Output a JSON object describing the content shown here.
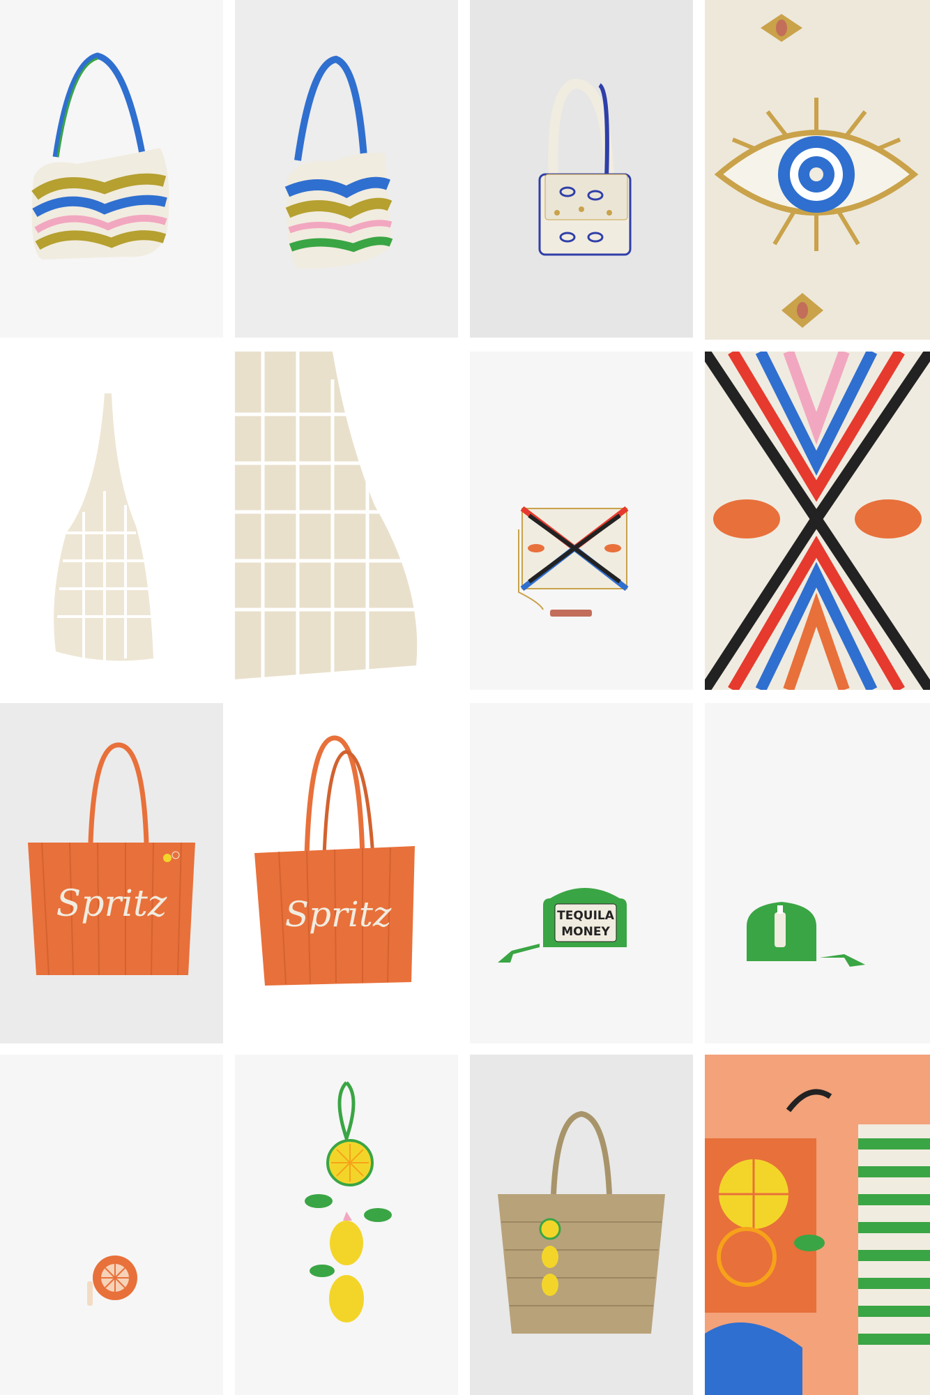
{
  "grid": {
    "background": "#ffffff",
    "tiles": [
      {
        "name": "wave-beaded-shoulder-bag-front",
        "bg": "#f6f6f6"
      },
      {
        "name": "wave-beaded-shoulder-bag-angle",
        "bg": "#ededed"
      },
      {
        "name": "evil-eye-beaded-bag",
        "bg": "#e6e6e6"
      },
      {
        "name": "evil-eye-beading-detail",
        "bg": "#eee8db"
      },
      {
        "name": "crochet-net-tote-full",
        "bg": "#ffffff"
      },
      {
        "name": "crochet-net-tote-detail",
        "bg": "#ffffff"
      },
      {
        "name": "zigzag-beaded-clutch",
        "bg": "#f6f6f6"
      },
      {
        "name": "zigzag-embroidery-detail",
        "bg": "#f0ebe0"
      },
      {
        "name": "spritz-tote-front",
        "bg": "#ebebeb"
      },
      {
        "name": "spritz-tote-angle",
        "bg": "#ffffff"
      },
      {
        "name": "tequila-money-pouch",
        "bg": "#f6f6f6"
      },
      {
        "name": "bottle-beaded-pouch",
        "bg": "#f6f6f6"
      },
      {
        "name": "orange-slice-coin-purse",
        "bg": "#f6f6f6"
      },
      {
        "name": "lemon-bag-charm",
        "bg": "#f6f6f6"
      },
      {
        "name": "straw-tote-with-lemon-charm",
        "bg": "#e8e8e8"
      },
      {
        "name": "citrus-beading-detail",
        "bg": "#f3a27a"
      }
    ]
  },
  "products": {
    "spritz_text": "Spritz",
    "tequila_line1": "TEQUILA",
    "tequila_line2": "MONEY"
  },
  "colors": {
    "orange": "#e8703a",
    "green": "#3aa544",
    "blue": "#2f6fcf",
    "mustard": "#b5a030",
    "cream": "#f1ece0",
    "pink": "#f2a7c0",
    "lemon": "#f3d52a"
  }
}
